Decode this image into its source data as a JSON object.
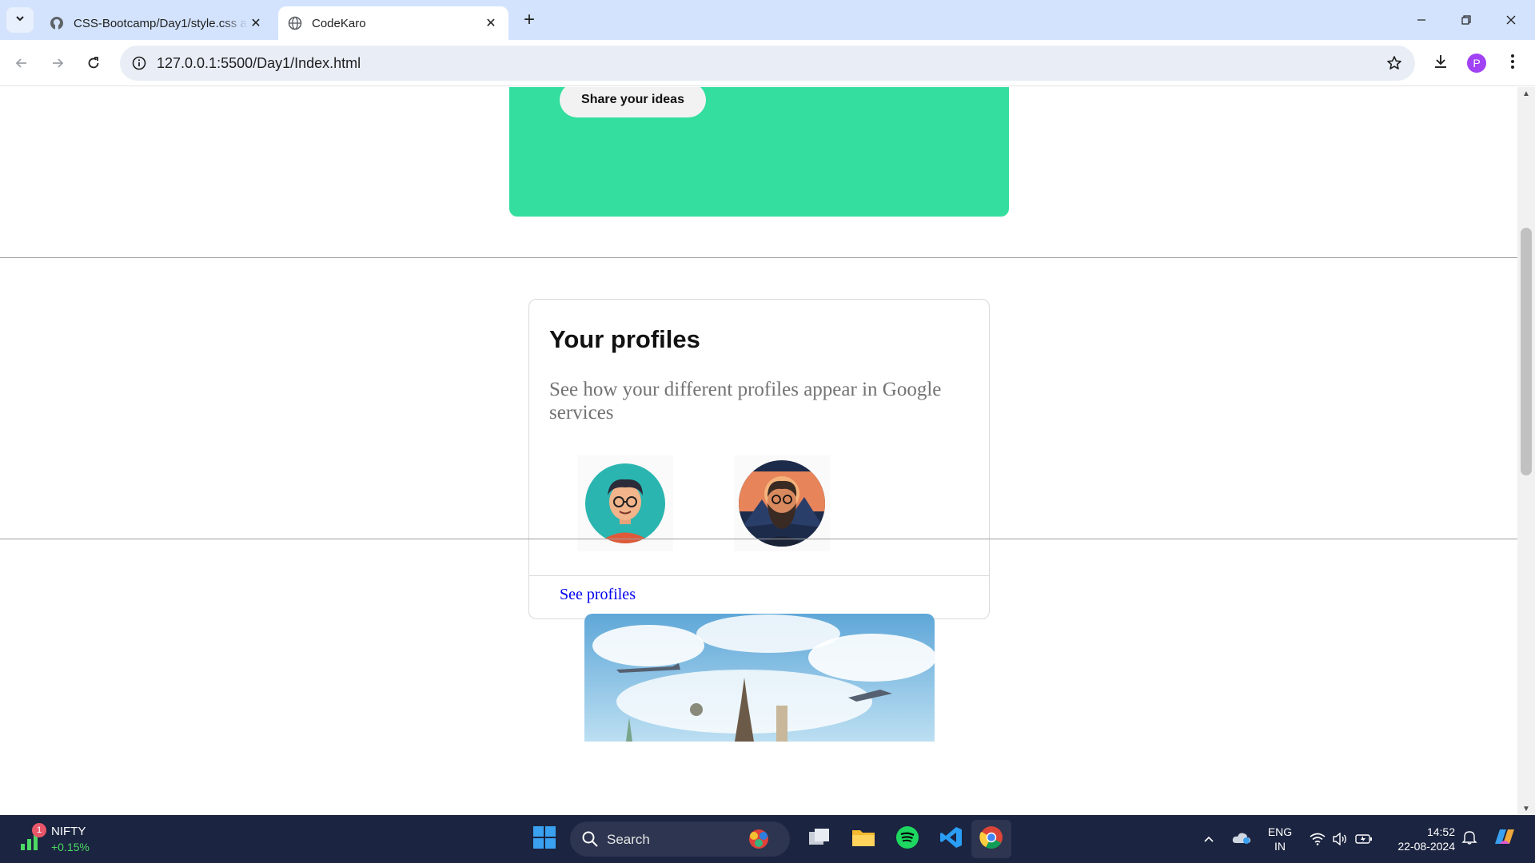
{
  "browser": {
    "tabs": [
      {
        "title": "CSS-Bootcamp/Day1/style.css at",
        "active": false
      },
      {
        "title": "CodeKaro",
        "active": true
      }
    ],
    "url": "127.0.0.1:5500/Day1/Index.html",
    "profile_initial": "P"
  },
  "page": {
    "hero": {
      "button_label": "Share your ideas",
      "card_color": "#33de9e"
    },
    "profiles": {
      "title": "Your profiles",
      "description": "See how your different profiles appear in Google services",
      "link_label": "See profiles"
    }
  },
  "taskbar": {
    "ticker": {
      "name": "NIFTY",
      "change": "+0.15%",
      "badge": "1"
    },
    "search_placeholder": "Search",
    "language": {
      "line1": "ENG",
      "line2": "IN"
    },
    "clock": {
      "time": "14:52",
      "date": "22-08-2024"
    }
  }
}
